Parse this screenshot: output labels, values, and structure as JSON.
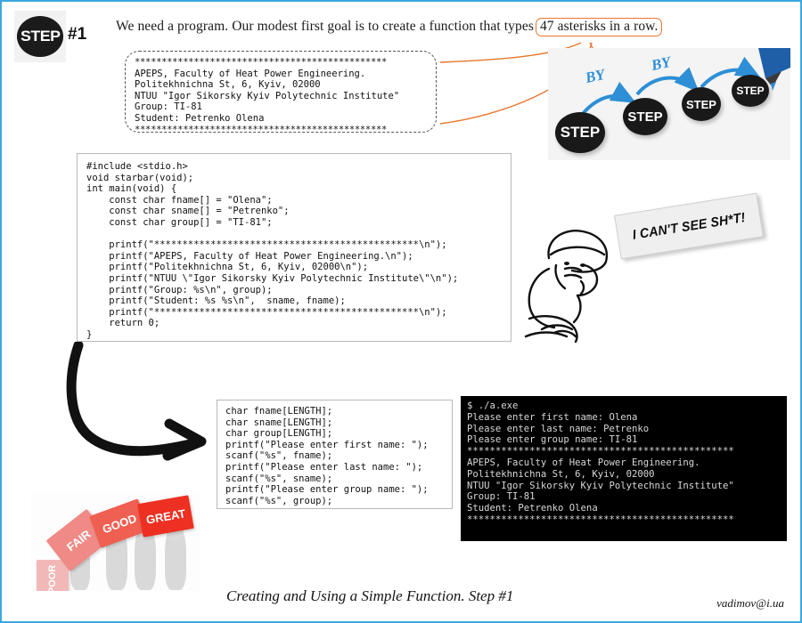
{
  "slide": {
    "border_color": "#3aa8e0",
    "accent_orange": "#e8772e",
    "accent_blue": "#2e8fd6"
  },
  "header": {
    "step_badge_label": "STEP",
    "step_number": "#1",
    "headline_prefix": "We need a program. Our modest first goal is to create a function that types",
    "headline_highlight": "47 asterisks in a row."
  },
  "output_box": {
    "line_top_stars": "***********************************************",
    "line1": "APEPS, Faculty of Heat Power Engineering.",
    "line2": "Politekhnichna St, 6, Kyiv, 02000",
    "line3": "NTUU \"Igor Sikorsky Kyiv Polytechnic Institute\"",
    "line4": "Group: TI-81",
    "line5": "Student: Petrenko Olena",
    "line_bottom_stars": "***********************************************"
  },
  "step_by_step": {
    "ovals": [
      "STEP",
      "STEP",
      "STEP",
      "STEP"
    ],
    "connectors": [
      "BY",
      "BY"
    ]
  },
  "main_code": {
    "lines": [
      "#include <stdio.h>",
      "void starbar(void);",
      "int main(void) {",
      "    const char fname[] = \"Olena\";",
      "    const char sname[] = \"Petrenko\";",
      "    const char group[] = \"TI-81\";",
      "",
      "    printf(\"***********************************************\\n\");",
      "    printf(\"APEPS, Faculty of Heat Power Engineering.\\n\");",
      "    printf(\"Politekhnichna St, 6, Kyiv, 02000\\n\");",
      "    printf(\"NTUU \\\"Igor Sikorsky Kyiv Polytechnic Institute\\\"\\n\");",
      "    printf(\"Group: %s\\n\", group);",
      "    printf(\"Student: %s %s\\n\",  sname, fname);",
      "    printf(\"***********************************************\\n\");",
      "    return 0;",
      "}"
    ]
  },
  "input_code": {
    "lines": [
      "char fname[LENGTH];",
      "char sname[LENGTH];",
      "char group[LENGTH];",
      "printf(\"Please enter first name: \");",
      "scanf(\"%s\", fname);",
      "printf(\"Please enter last name: \");",
      "scanf(\"%s\", sname);",
      "printf(\"Please enter group name: \");",
      "scanf(\"%s\", group);"
    ]
  },
  "terminal": {
    "lines": [
      "$ ./a.exe",
      "Please enter first name: Olena",
      "Please enter last name: Petrenko",
      "Please enter group name: TI-81",
      "***********************************************",
      "APEPS, Faculty of Heat Power Engineering.",
      "Politekhnichna St, 6, Kyiv, 02000",
      "NTUU \"Igor Sikorsky Kyiv Polytechnic Institute\"",
      "Group: TI-81",
      "Student: Petrenko Olena",
      "***********************************************"
    ]
  },
  "cartoon": {
    "sign_text": "I CAN'T SEE SH*T!"
  },
  "rating": {
    "blocks": [
      "POOR",
      "FAIR",
      "GOOD",
      "GREAT"
    ]
  },
  "footer": {
    "title": "Creating and Using a Simple Function. Step #1",
    "email": "vadimov@i.ua"
  }
}
